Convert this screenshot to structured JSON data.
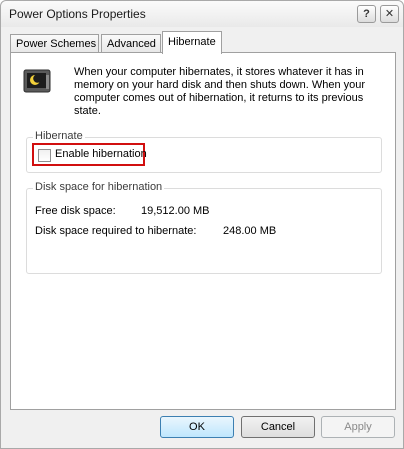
{
  "window": {
    "title": "Power Options Properties",
    "help_label": "?",
    "close_label": "✕"
  },
  "tabs": [
    {
      "label": "Power Schemes",
      "selected": false
    },
    {
      "label": "Advanced",
      "selected": false
    },
    {
      "label": "Hibernate",
      "selected": true
    }
  ],
  "description": "When your computer hibernates, it stores whatever it has in memory on your hard disk and then shuts down. When your computer comes out of hibernation, it returns to its previous state.",
  "hibernate_group": {
    "title": "Hibernate",
    "checkbox_label": "Enable hibernation",
    "checked": false,
    "highlight_color": "#d10f0f"
  },
  "disk_group": {
    "title": "Disk space for hibernation",
    "free_label": "Free disk space:",
    "free_value": "19,512.00 MB",
    "required_label": "Disk space required to hibernate:",
    "required_value": "248.00 MB"
  },
  "buttons": {
    "ok": "OK",
    "cancel": "Cancel",
    "apply": "Apply"
  },
  "icons": {
    "hibernate": "monitor-moon-icon"
  }
}
